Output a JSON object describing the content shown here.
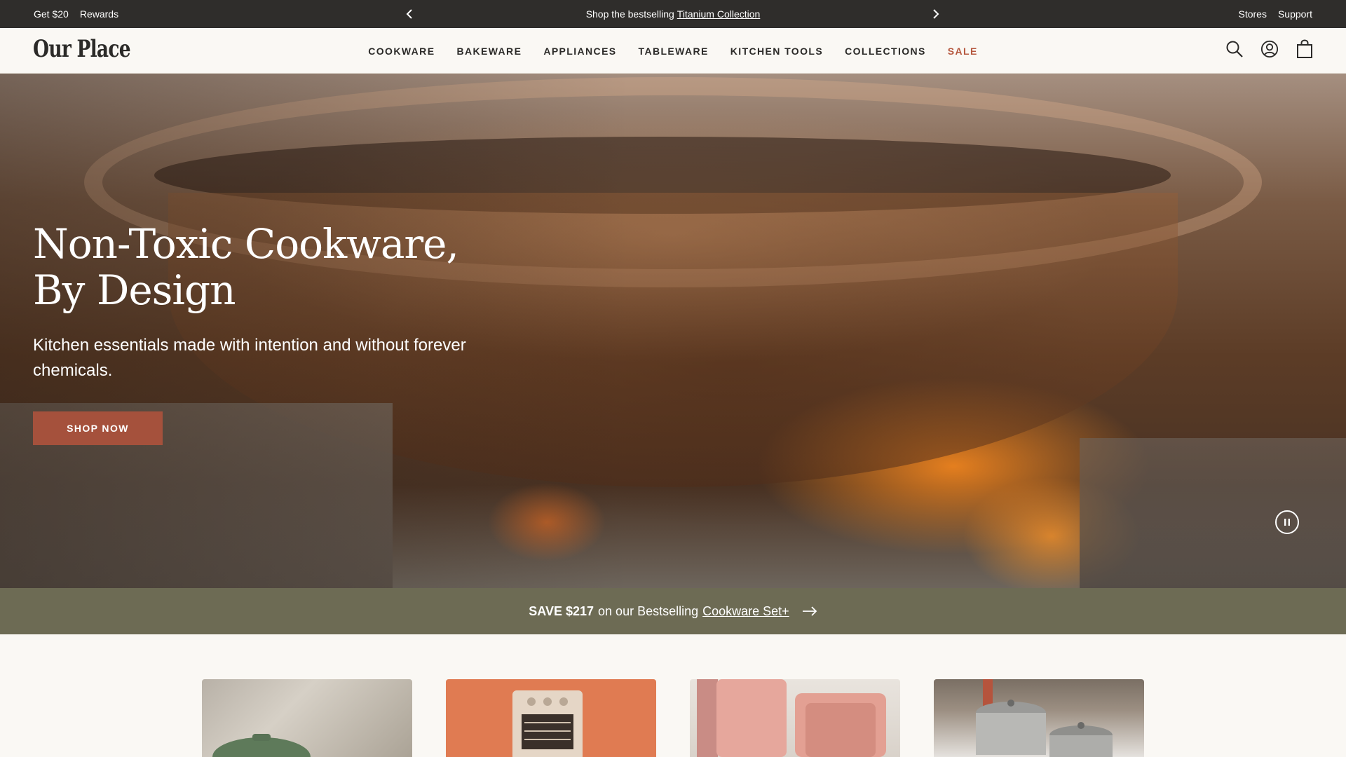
{
  "topbar": {
    "left_links": [
      "Get $20",
      "Rewards"
    ],
    "promo_text": "Shop the bestselling",
    "promo_link": "Titanium Collection",
    "right_links": [
      "Stores",
      "Support"
    ]
  },
  "header": {
    "logo": "Our Place",
    "nav": [
      "COOKWARE",
      "BAKEWARE",
      "APPLIANCES",
      "TABLEWARE",
      "KITCHEN TOOLS",
      "COLLECTIONS",
      "SALE"
    ],
    "icons": [
      "search-icon",
      "account-icon",
      "cart-icon"
    ]
  },
  "hero": {
    "title_line1": "Non-Toxic Cookware,",
    "title_line2": "By Design",
    "subtitle": "Kitchen essentials made with intention and without forever chemicals.",
    "cta": "SHOP NOW"
  },
  "promo_strip": {
    "bold": "SAVE $217",
    "text": "on our Bestselling",
    "link": "Cookware Set+"
  },
  "colors": {
    "topbar_bg": "#2f2d2b",
    "accent": "#a5513c",
    "sale": "#b5573e",
    "promo_bg": "#6d6b54"
  }
}
